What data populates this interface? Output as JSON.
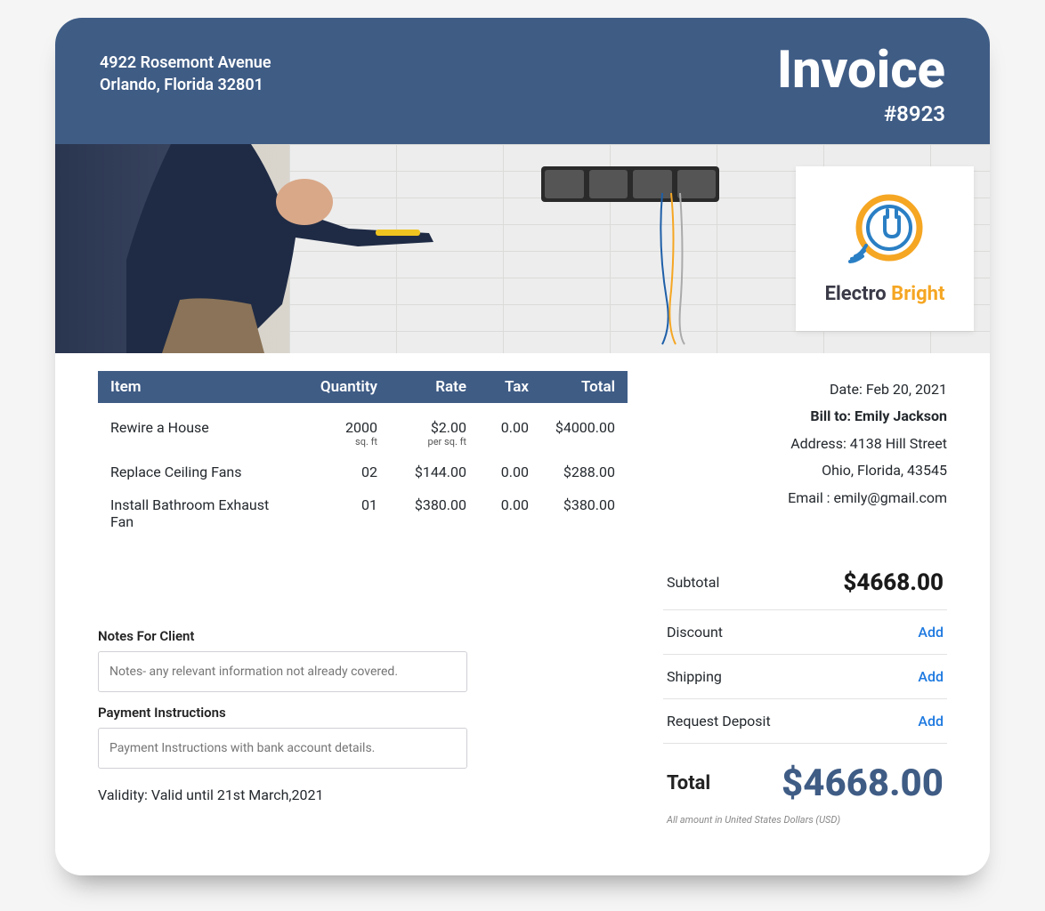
{
  "company": {
    "address_line1": "4922 Rosemont Avenue",
    "address_line2": "Orlando, Florida 32801",
    "logo_part1": "Electro",
    "logo_part2": "Bright"
  },
  "doc": {
    "title": "Invoice",
    "number": "#8923"
  },
  "bill": {
    "date_label": "Date:",
    "date": "Feb 20, 2021",
    "to_label": "Bill to:",
    "to_name": "Emily Jackson",
    "address_label": "Address:",
    "address_line1": "4138 Hill Street",
    "address_line2": "Ohio, Florida, 43545",
    "email_label": "Email :",
    "email": "emily@gmail.com"
  },
  "headers": {
    "item": "Item",
    "qty": "Quantity",
    "rate": "Rate",
    "tax": "Tax",
    "total": "Total"
  },
  "items": [
    {
      "name": "Rewire a House",
      "qty": "2000",
      "qty_unit": "sq. ft",
      "rate": "$2.00",
      "rate_unit": "per sq. ft",
      "tax": "0.00",
      "total": "$4000.00"
    },
    {
      "name": "Replace Ceiling Fans",
      "qty": "02",
      "qty_unit": "",
      "rate": "$144.00",
      "rate_unit": "",
      "tax": "0.00",
      "total": "$288.00"
    },
    {
      "name": "Install Bathroom Exhaust Fan",
      "qty": "01",
      "qty_unit": "",
      "rate": "$380.00",
      "rate_unit": "",
      "tax": "0.00",
      "total": "$380.00"
    }
  ],
  "summary": {
    "subtotal_label": "Subtotal",
    "subtotal": "$4668.00",
    "discount_label": "Discount",
    "shipping_label": "Shipping",
    "deposit_label": "Request Deposit",
    "add": "Add",
    "total_label": "Total",
    "total": "$4668.00",
    "currency_note": "All amount in United States Dollars (USD)"
  },
  "notes": {
    "client_label": "Notes For Client",
    "client_placeholder": "Notes- any relevant information not already covered.",
    "payment_label": "Payment Instructions",
    "payment_placeholder": "Payment Instructions with bank account details.",
    "validity_label": "Validity:",
    "validity_value": "Valid until 21st March,2021"
  }
}
